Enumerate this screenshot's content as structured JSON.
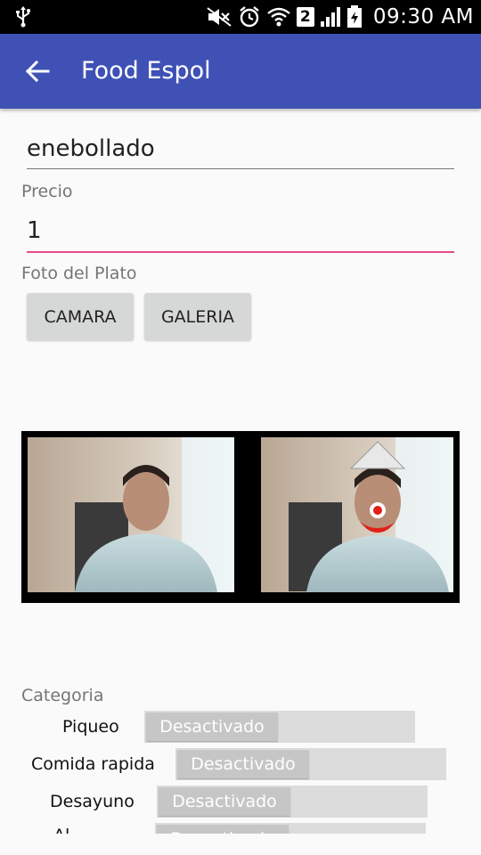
{
  "status_bar": {
    "time": "09:30 AM",
    "sim_slot": "2",
    "icons": [
      "usb-icon",
      "mute-icon",
      "alarm-icon",
      "wifi-icon",
      "signal-icon",
      "battery-icon"
    ]
  },
  "app_bar": {
    "title": "Food Espol",
    "back_icon": "arrow-left-icon",
    "color": "#3f51b5"
  },
  "form": {
    "name_value": "enebollado",
    "price_label": "Precio",
    "price_value": "1",
    "photo_label": "Foto del Plato",
    "camera_button": "CAMARA",
    "gallery_button": "GALERIA",
    "accent_color": "#e94a8d"
  },
  "categories": {
    "label": "Categoria",
    "items": [
      {
        "name": "Piqueo",
        "state": "Desactivado"
      },
      {
        "name": "Comida rapida",
        "state": "Desactivado"
      },
      {
        "name": "Desayuno",
        "state": "Desactivado"
      },
      {
        "name": "Al",
        "state": "Desactivado"
      }
    ]
  }
}
